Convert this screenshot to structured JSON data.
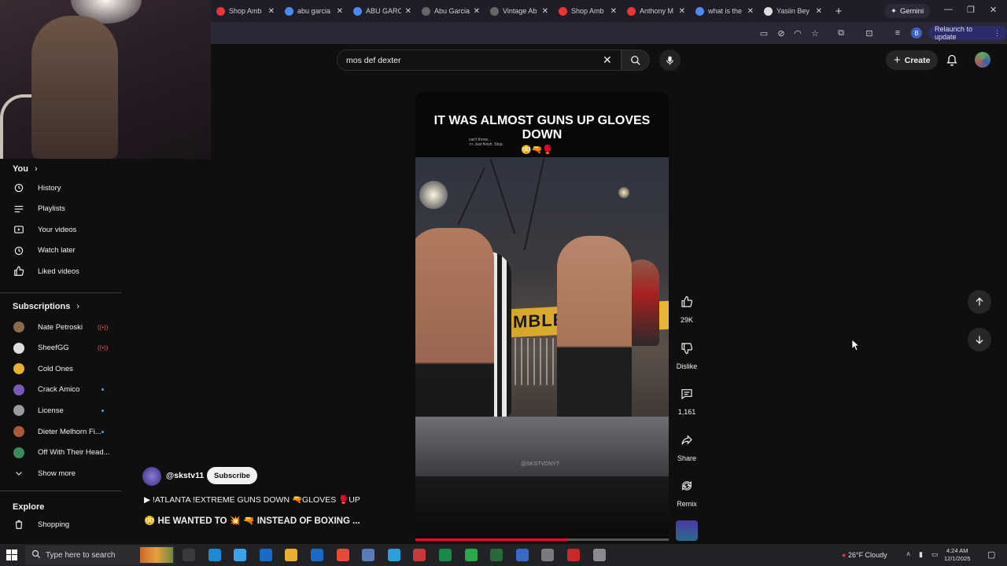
{
  "browser": {
    "tabs": [
      {
        "label": "Shop Amb",
        "color": "#e33"
      },
      {
        "label": "abu garcia",
        "color": "#4a8af4"
      },
      {
        "label": "ABU GARC",
        "color": "#4a8af4"
      },
      {
        "label": "Abu Garcia",
        "color": "#666"
      },
      {
        "label": "Vintage Ab",
        "color": "#666"
      },
      {
        "label": "Shop Amb",
        "color": "#e33"
      },
      {
        "label": "Anthony M",
        "color": "#e33"
      },
      {
        "label": "what is the",
        "color": "#4a8af4"
      },
      {
        "label": "Yasiin Bey",
        "color": "#ddd"
      }
    ],
    "new_tab": "+",
    "gemini_label": "Gemini",
    "profile_initial": "B",
    "relaunch_label": "Relaunch to update"
  },
  "youtube": {
    "search_value": "mos def dexter",
    "create_label": "Create"
  },
  "sidebar": {
    "you_label": "You",
    "you_items": [
      {
        "label": "History",
        "icon": "history-icon"
      },
      {
        "label": "Playlists",
        "icon": "playlists-icon"
      },
      {
        "label": "Your videos",
        "icon": "your-videos-icon"
      },
      {
        "label": "Watch later",
        "icon": "watch-later-icon"
      },
      {
        "label": "Liked videos",
        "icon": "liked-videos-icon"
      }
    ],
    "subscriptions_label": "Subscriptions",
    "subscriptions": [
      {
        "label": "Nate Petroski",
        "color": "#8a6a4a",
        "status": "live"
      },
      {
        "label": "SheefGG",
        "color": "#dddddd",
        "status": "live"
      },
      {
        "label": "Cold Ones",
        "color": "#e8b030",
        "status": "none"
      },
      {
        "label": "Crack Amico",
        "color": "#7a5ab8",
        "status": "new"
      },
      {
        "label": "License",
        "color": "#9a9aa0",
        "status": "new"
      },
      {
        "label": "Dieter Melhorn Fi...",
        "color": "#a85a3a",
        "status": "new"
      },
      {
        "label": "Off With Their Head...",
        "color": "#3a8a5a",
        "status": "none"
      }
    ],
    "show_more": "Show more",
    "explore_label": "Explore",
    "explore_items": [
      {
        "label": "Shopping",
        "icon": "shopping-icon"
      }
    ]
  },
  "video": {
    "title_text": "IT WAS ALMOST GUNS UP GLOVES DOWN",
    "overlay_small": "can't throw...\n>> Just finish. Stop.",
    "emoji": "😳🔫🥊",
    "scene_banner": "MBLE   TLA",
    "watermark": "@SKSTVDNYT",
    "progress_fraction": 0.6
  },
  "channel": {
    "handle": "@skstv11",
    "subscribe_label": "Subscribe"
  },
  "description": {
    "line1": "▶ !ATLANTA !EXTREME GUNS DOWN 🔫GLOVES 🥊UP",
    "line2": "😳 HE WANTED TO 💥 🔫 INSTEAD OF BOXING ..."
  },
  "actions": {
    "like_count": "29K",
    "dislike_label": "Dislike",
    "comment_count": "1,161",
    "share_label": "Share",
    "remix_label": "Remix"
  },
  "taskbar": {
    "search_placeholder": "Type here to search",
    "weather": "26°F  Cloudy",
    "time": "4:24 AM",
    "date": "12/1/2025"
  }
}
